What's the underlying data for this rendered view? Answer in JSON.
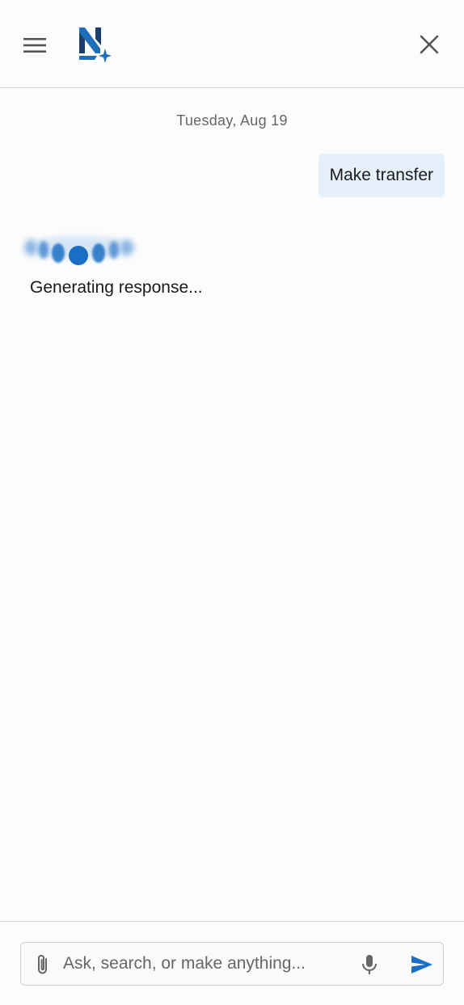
{
  "header": {
    "menu_icon": "hamburger-menu-icon",
    "logo_icon": "brand-logo-icon",
    "close_icon": "close-icon",
    "brand_colors": {
      "dark": "#1b3f6b",
      "mid": "#1f6fb8"
    }
  },
  "conversation": {
    "date_label": "Tuesday, Aug 19",
    "user_message": "Make transfer",
    "status_text": "Generating response...",
    "thinking_icon": "loading-dots-icon",
    "accent_color": "#1a6fc4",
    "user_bubble_color": "#e6f0fa"
  },
  "composer": {
    "placeholder": "Ask, search, or make anything...",
    "attach_icon": "paperclip-icon",
    "mic_icon": "microphone-icon",
    "send_icon": "send-icon"
  }
}
